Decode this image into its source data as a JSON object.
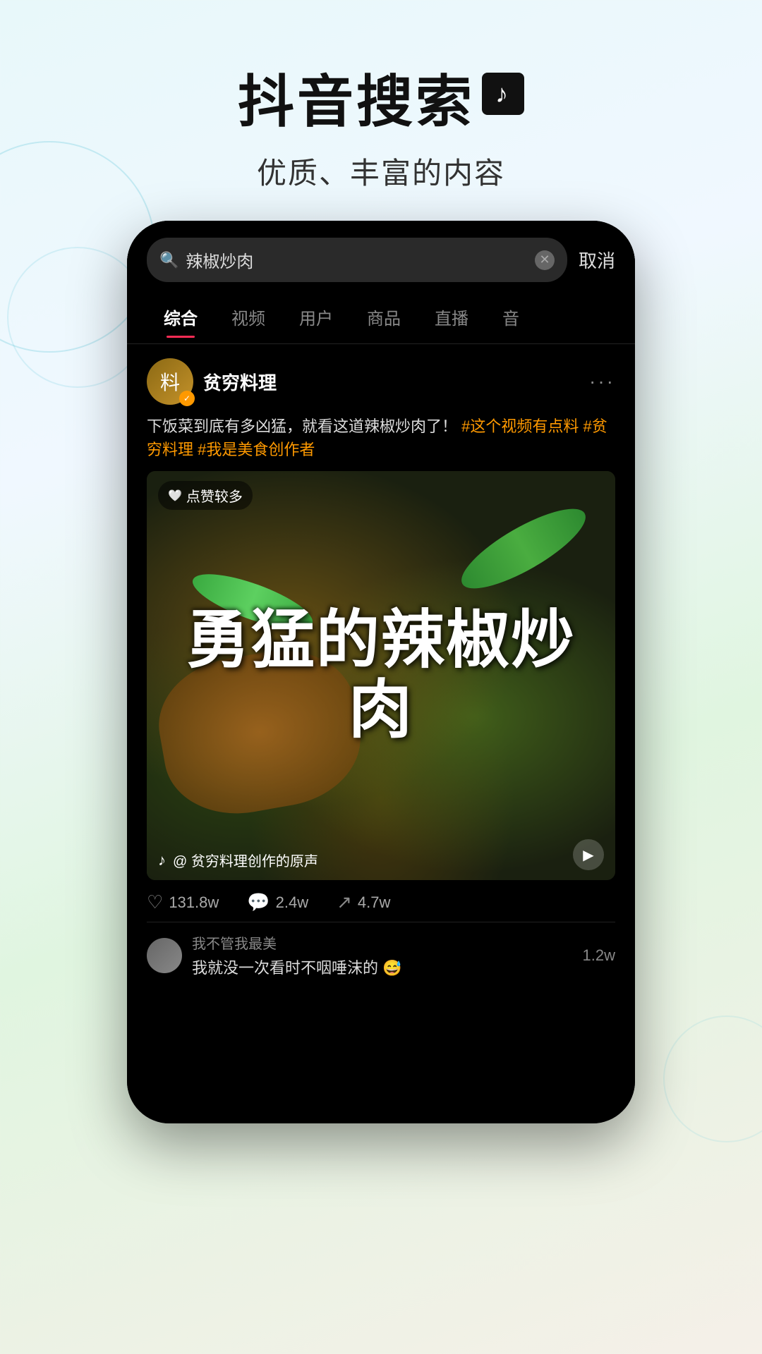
{
  "header": {
    "title": "抖音搜索",
    "logo_symbol": "♪",
    "subtitle": "优质、丰富的内容"
  },
  "phone": {
    "search_bar": {
      "query": "辣椒炒肉",
      "placeholder": "辣椒炒肉",
      "cancel_label": "取消",
      "search_icon": "🔍",
      "clear_icon": "✕"
    },
    "tabs": [
      {
        "label": "综合",
        "active": true
      },
      {
        "label": "视频",
        "active": false
      },
      {
        "label": "用户",
        "active": false
      },
      {
        "label": "商品",
        "active": false
      },
      {
        "label": "直播",
        "active": false
      },
      {
        "label": "音",
        "active": false
      }
    ],
    "post": {
      "username": "贫穷料理",
      "avatar_text": "料",
      "verified": true,
      "more_dots": "···",
      "text_plain": "下饭菜到底有多凶猛，就看这道辣椒炒肉了！",
      "hashtags": [
        "#这个视频有点料",
        "#贫穷料理",
        "#我是美食创作者"
      ],
      "video": {
        "likes_badge": "点赞较多",
        "calligraphy": "勇猛的辣椒炒肉",
        "audio_text": "@ 贫穷料理创作的原声",
        "play_icon": "▶"
      },
      "stats": {
        "likes": "131.8w",
        "comments": "2.4w",
        "shares": "4.7w",
        "like_icon": "♡",
        "comment_icon": "💬",
        "share_icon": "↗"
      },
      "comments": [
        {
          "username": "我不管我最美",
          "text": "我就没一次看时不咽唾沫的 😅",
          "count": "1.2w"
        }
      ]
    }
  },
  "colors": {
    "accent": "#FE2C55",
    "gold": "#FE9900",
    "bg_dark": "#000000",
    "text_primary": "#ffffff",
    "text_secondary": "#888888"
  }
}
